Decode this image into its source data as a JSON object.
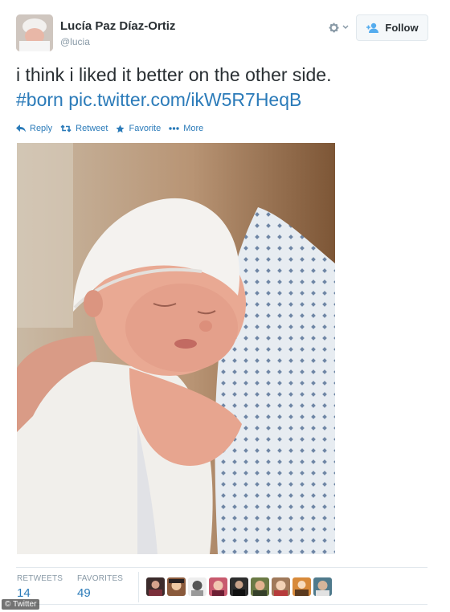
{
  "header": {
    "display_name": "Lucía Paz Díaz-Ortiz",
    "handle": "@lucia",
    "follow_label": "Follow",
    "avatar_icon": "baby-avatar",
    "settings_icon": "gear-icon"
  },
  "tweet": {
    "text_line1": "i think i liked it better on the other side.",
    "hashtag": "#born",
    "photo_link": "pic.twitter.com/ikW5R7HeqB"
  },
  "actions": {
    "reply": "Reply",
    "retweet": "Retweet",
    "favorite": "Favorite",
    "more": "More"
  },
  "stats": {
    "retweets_label": "RETWEETS",
    "retweets_value": "14",
    "favorites_label": "FAVORITES",
    "favorites_value": "49",
    "favoriter_avatars": 9
  },
  "watermark": "© Twitter",
  "colors": {
    "link": "#2b7bb9",
    "text": "#292f33",
    "muted": "#8899a6",
    "border": "#e1e8ed"
  }
}
